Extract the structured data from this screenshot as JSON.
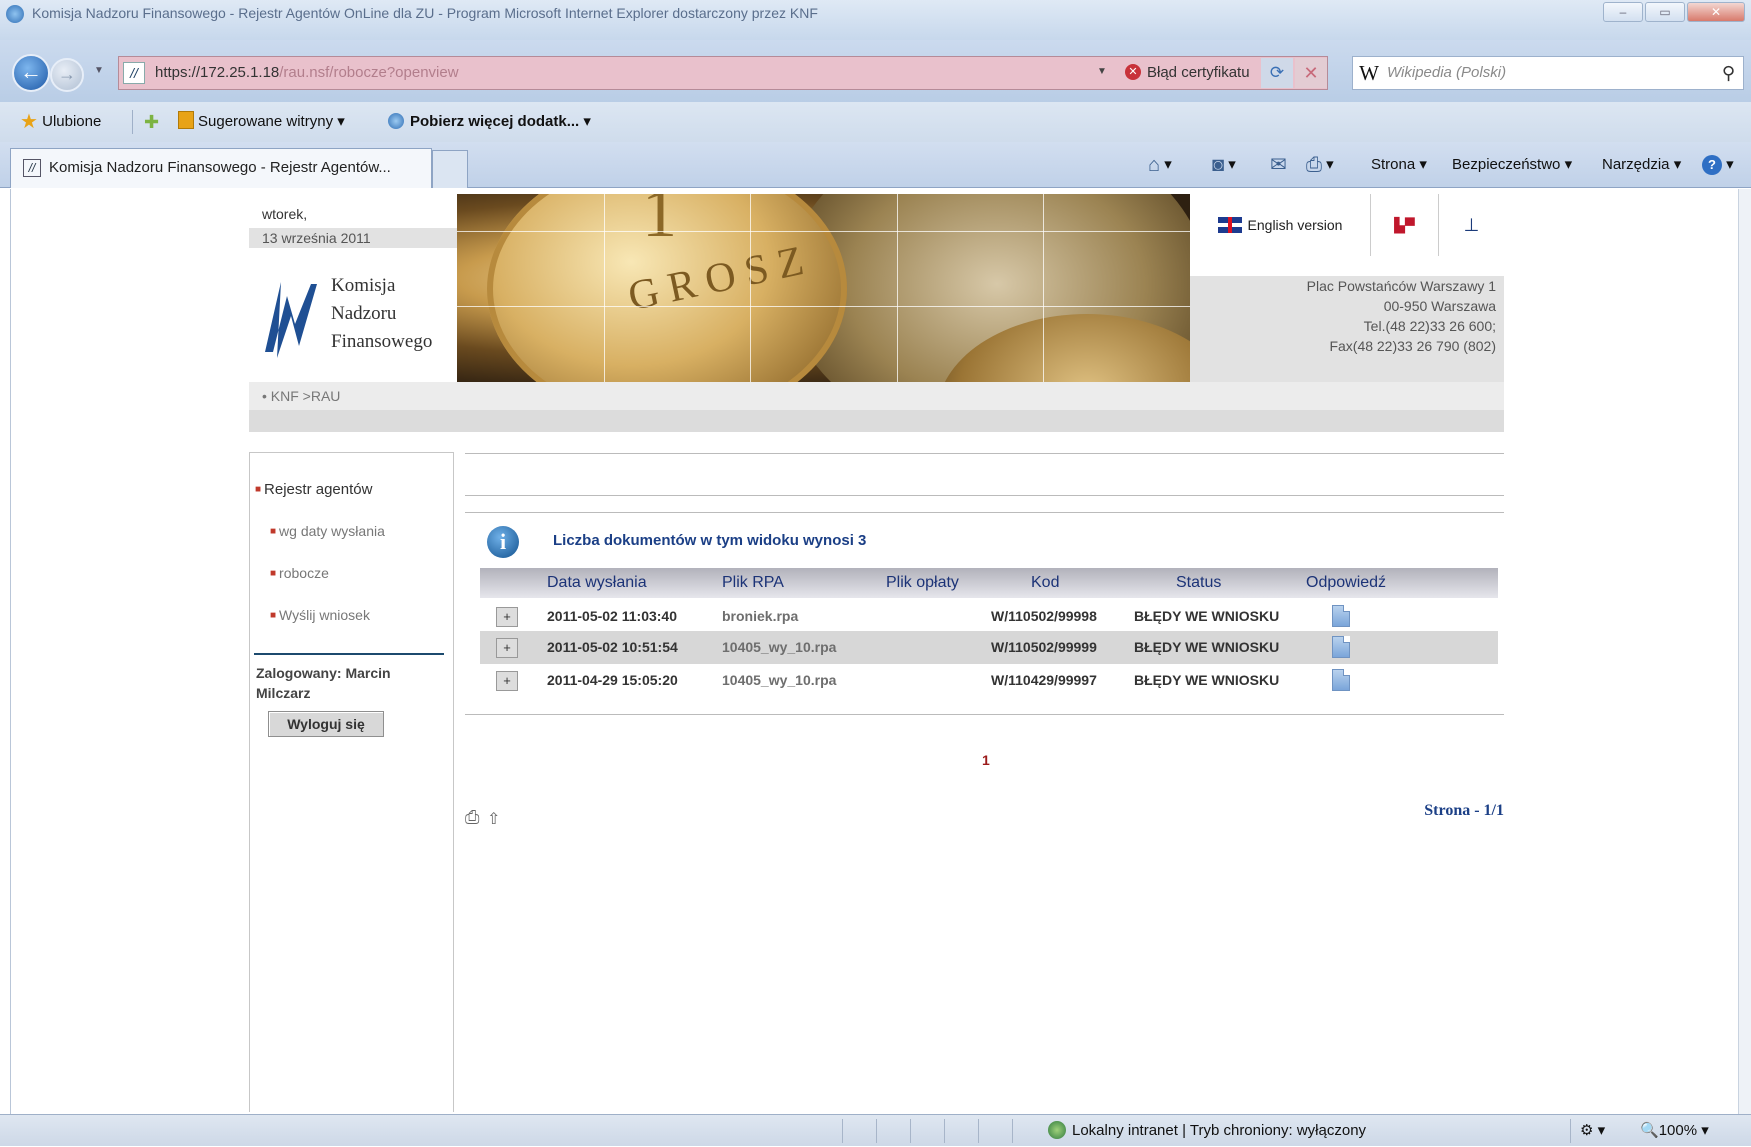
{
  "browser": {
    "title": "Komisja Nadzoru Finansowego - Rejestr Agentów OnLine dla ZU - Program Microsoft Internet Explorer dostarczony przez KNF",
    "url_host": "https://172.25.1.18",
    "url_path": "/rau.nsf/robocze?openview",
    "cert_error": "Błąd certyfikatu",
    "search_placeholder": "Wikipedia (Polski)",
    "favorites_label": "Ulubione",
    "suggested_sites": "Sugerowane witryny",
    "more_addons": "Pobierz więcej dodatk...",
    "tab_title": "Komisja Nadzoru Finansowego - Rejestr Agentów...",
    "cmd_page": "Strona",
    "cmd_safety": "Bezpieczeństwo",
    "cmd_tools": "Narzędzia",
    "status_zone": "Lokalny intranet | Tryb chroniony: wyłączony",
    "zoom": "100%"
  },
  "header": {
    "day": "wtorek,",
    "date": "13 września 2011",
    "logo_lines": [
      "Komisja",
      "Nadzoru",
      "Finansowego"
    ],
    "coin_text": "GROSZ",
    "coin_number": "1",
    "english_version": "English version",
    "address_lines": [
      "Plac Powstańców Warszawy 1",
      "00-950 Warszawa",
      "Tel.(48 22)33 26 600;",
      "Fax(48 22)33 26 790 (802)"
    ],
    "breadcrumb": "• KNF >RAU"
  },
  "sidebar": {
    "main_item": "Rejestr agentów",
    "sub_items": [
      "wg daty wysłania",
      "robocze",
      "Wyślij wniosek"
    ],
    "logged_in": "Zalogowany: Marcin Milczarz",
    "logout": "Wyloguj się"
  },
  "main": {
    "count_text": "Liczba dokumentów w tym widoku wynosi 3",
    "columns": [
      "Data wysłania",
      "Plik RPA",
      "Plik opłaty",
      "Kod",
      "Status",
      "Odpowiedź"
    ],
    "rows": [
      {
        "expand": "+",
        "date": "2011-05-02 11:03:40",
        "rpa": "broniek.rpa",
        "fee": "",
        "code": "W/110502/99998",
        "status": "BŁĘDY WE WNIOSKU"
      },
      {
        "expand": "+",
        "date": "2011-05-02 10:51:54",
        "rpa": "10405_wy_10.rpa",
        "fee": "",
        "code": "W/110502/99999",
        "status": "BŁĘDY WE WNIOSKU"
      },
      {
        "expand": "+",
        "date": "2011-04-29 15:05:20",
        "rpa": "10405_wy_10.rpa",
        "fee": "",
        "code": "W/110429/99997",
        "status": "BŁĘDY WE WNIOSKU"
      }
    ],
    "page_number": "1",
    "page_of": "Strona - 1/1"
  }
}
